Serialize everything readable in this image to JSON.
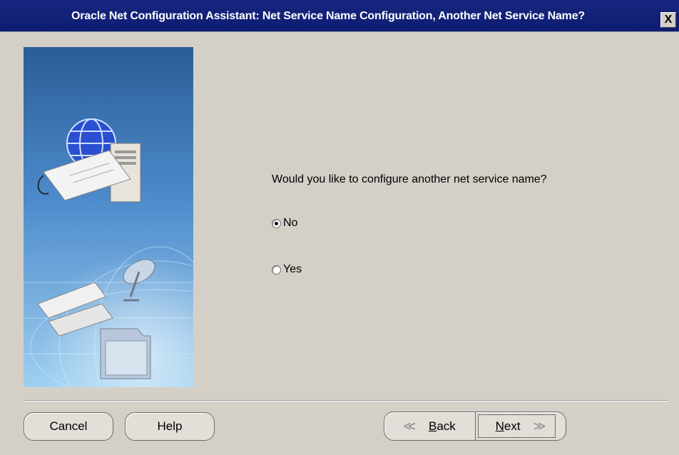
{
  "window": {
    "title": "Oracle Net Configuration Assistant: Net Service Name Configuration, Another Net Service Name?",
    "close_label": "X"
  },
  "main": {
    "question": "Would you like to configure another net service name?",
    "options": [
      {
        "label": "No",
        "selected": true
      },
      {
        "label": "Yes",
        "selected": false
      }
    ]
  },
  "footer": {
    "cancel_label": "Cancel",
    "help_label": "Help",
    "back_mnemonic": "B",
    "back_rest": "ack",
    "next_mnemonic": "N",
    "next_rest": "ext"
  },
  "icons": {
    "banner": "oracle-net-wizard-banner",
    "back_chevron": "double-chevron-left-icon",
    "next_chevron": "double-chevron-right-icon"
  },
  "colors": {
    "titlebar": "#17267e",
    "dialog_bg": "#d4d0c8",
    "banner_top": "#2b5d98",
    "banner_bottom": "#9fd0f0"
  }
}
